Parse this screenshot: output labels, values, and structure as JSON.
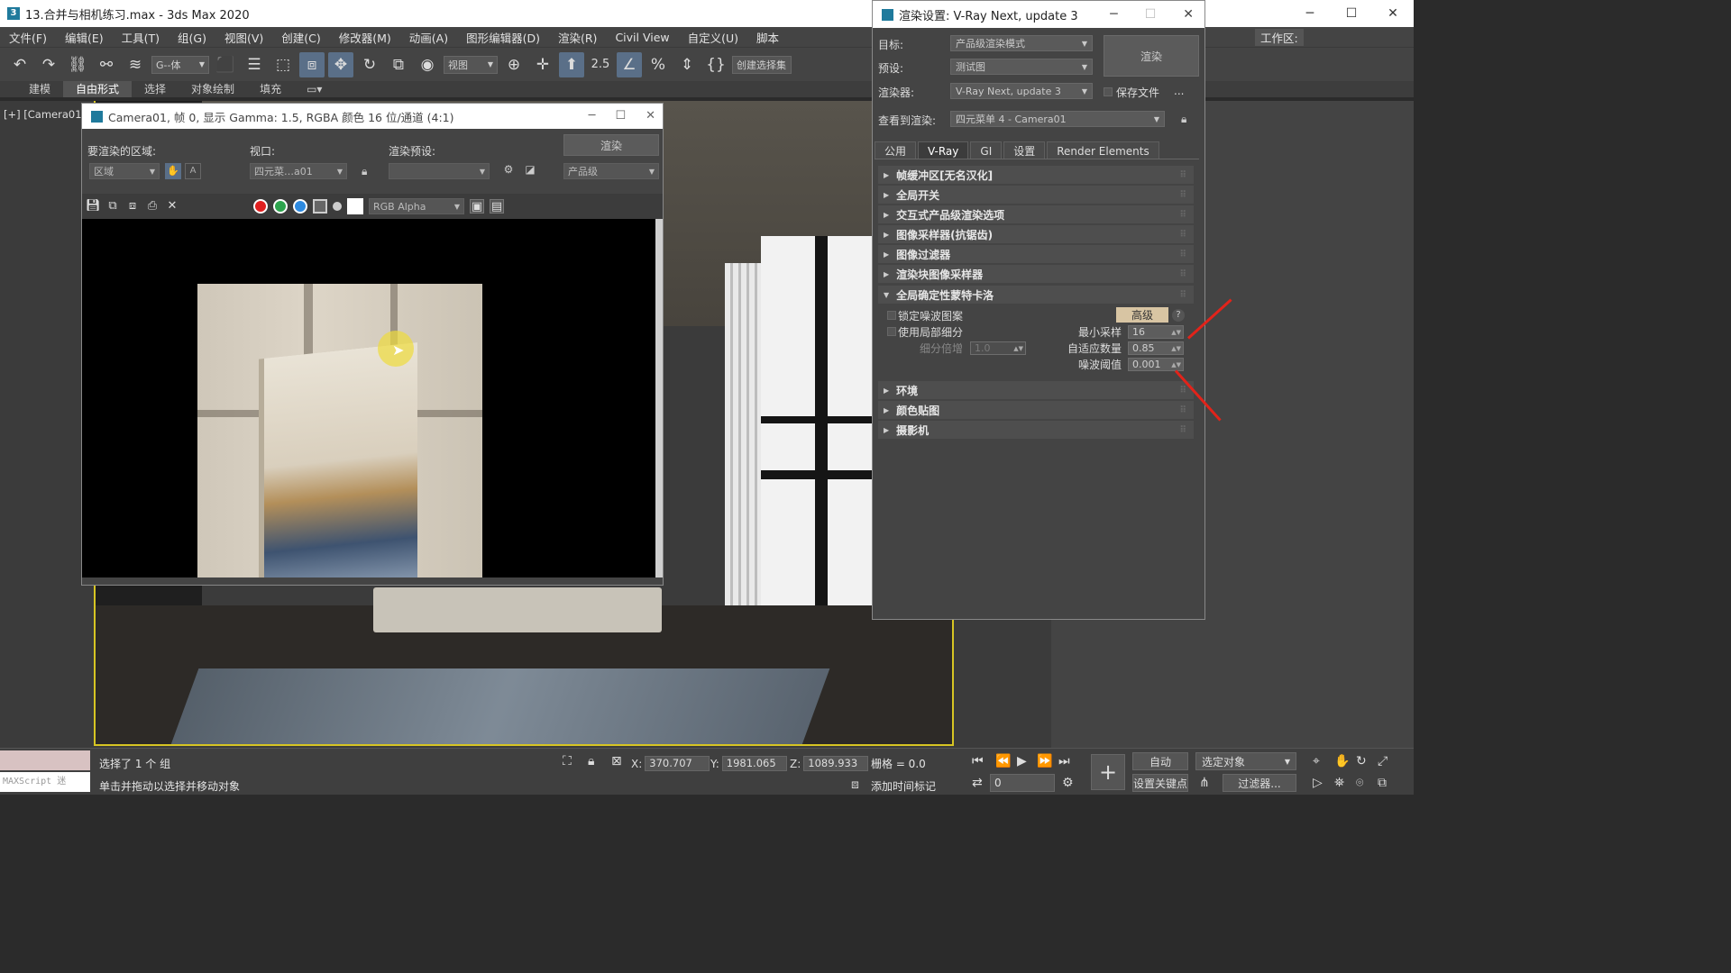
{
  "app": {
    "title": "13.合并与相机练习.max - 3ds Max 2020",
    "menu": [
      "文件(F)",
      "编辑(E)",
      "工具(T)",
      "组(G)",
      "视图(V)",
      "创建(C)",
      "修改器(M)",
      "动画(A)",
      "图形编辑器(D)",
      "渲染(R)",
      "Civil View",
      "自定义(U)",
      "脚本"
    ],
    "workspace_label": "工作区:",
    "toolbar": {
      "selection_filter": "G--体",
      "view_select": "视图",
      "create_selection_set": "创建选择集",
      "snap_angle": "2.5"
    },
    "ribbon_tabs": [
      "建模",
      "自由形式",
      "选择",
      "对象绘制",
      "填充"
    ],
    "ribbon_active": "自由形式"
  },
  "viewport": {
    "label": "[+] [Camera01]"
  },
  "frame_buffer": {
    "title": "Camera01, 帧 0, 显示 Gamma: 1.5, RGBA 颜色 16 位/通道 (4:1)",
    "area_label": "要渲染的区域:",
    "area_value": "区域",
    "viewport_label": "视口:",
    "viewport_value": "四元菜…a01",
    "preset_label": "渲染预设:",
    "preset_value": "",
    "render_button": "渲染",
    "quality_value": "产品级",
    "channel_value": "RGB Alpha"
  },
  "render_setup": {
    "title": "渲染设置: V-Ray Next, update 3",
    "target_label": "目标:",
    "target_value": "产品级渲染模式",
    "preset_label": "预设:",
    "preset_value": "测试图",
    "renderer_label": "渲染器:",
    "renderer_value": "V-Ray Next, update 3",
    "save_file_label": "保存文件",
    "more": "...",
    "view_label": "查看到渲染:",
    "view_value": "四元菜单 4 - Camera01",
    "render_button": "渲染",
    "tabs": [
      "公用",
      "V-Ray",
      "GI",
      "设置",
      "Render Elements"
    ],
    "active_tab": "V-Ray",
    "rollouts": [
      "帧缓冲区[无名汉化]",
      "全局开关",
      "交互式产品级渲染选项",
      "图像采样器(抗锯齿)",
      "图像过滤器",
      "渲染块图像采样器",
      "全局确定性蒙特卡洛"
    ],
    "rollouts_after": [
      "环境",
      "颜色贴图",
      "摄影机"
    ],
    "dmc": {
      "lock_noise_label": "锁定噪波图案",
      "use_local_label": "使用局部细分",
      "subdiv_mult_label": "细分倍增",
      "subdiv_mult_value": "1.0",
      "advanced_button": "高级",
      "help": "?",
      "min_samples_label": "最小采样",
      "min_samples_value": "16",
      "adaptive_label": "自适应数量",
      "adaptive_value": "0.85",
      "noise_label": "噪波阈值",
      "noise_value": "0.001"
    }
  },
  "status": {
    "selection": "选择了 1 个 组",
    "hint": "单击并拖动以选择并移动对象",
    "maxscript": "MAXScript 迷",
    "x_label": "X:",
    "x_value": "370.707",
    "y_label": "Y:",
    "y_value": "1981.065",
    "z_label": "Z:",
    "z_value": "1089.933",
    "grid_label": "栅格 = 0.0",
    "add_time_tag": "添加时间标记",
    "auto_key": "自动",
    "set_key": "设置关键点",
    "selected_object": "选定对象",
    "filters": "过滤器...",
    "frame_value": "0"
  },
  "colors": {
    "accent_yellow": "#d7c523",
    "arrow_red": "#e2231a",
    "advanced_btn": "#d8c5a3"
  }
}
